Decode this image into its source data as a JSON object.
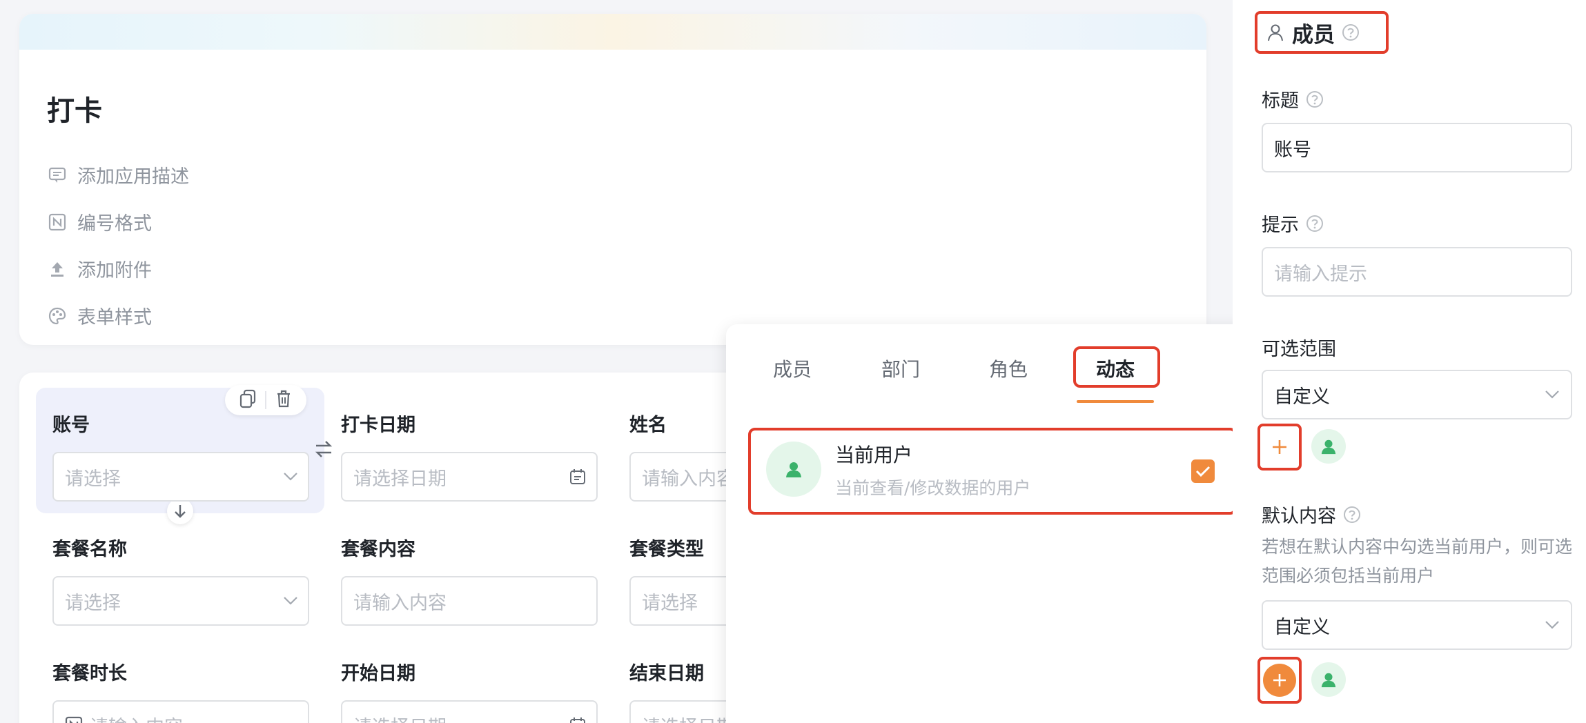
{
  "form": {
    "title": "打卡",
    "menu": [
      {
        "label": "添加应用描述",
        "icon": "comment-icon"
      },
      {
        "label": "编号格式",
        "icon": "number-format-icon"
      },
      {
        "label": "添加附件",
        "icon": "upload-icon"
      },
      {
        "label": "表单样式",
        "icon": "palette-icon"
      }
    ]
  },
  "fields": [
    {
      "label": "账号",
      "placeholder": "请选择",
      "type": "select"
    },
    {
      "label": "打卡日期",
      "placeholder": "请选择日期",
      "type": "date"
    },
    {
      "label": "姓名",
      "placeholder": "请输入内容",
      "type": "text"
    },
    {
      "label": "套餐名称",
      "placeholder": "请选择",
      "type": "select"
    },
    {
      "label": "套餐内容",
      "placeholder": "请输入内容",
      "type": "text"
    },
    {
      "label": "套餐类型",
      "placeholder": "请选择",
      "type": "select"
    },
    {
      "label": "套餐时长",
      "placeholder": "请输入内容",
      "type": "number"
    },
    {
      "label": "开始日期",
      "placeholder": "请选择日期",
      "type": "date"
    },
    {
      "label": "结束日期",
      "placeholder": "请选择日期",
      "type": "date"
    }
  ],
  "popup": {
    "tabs": [
      "成员",
      "部门",
      "角色",
      "动态"
    ],
    "active_tab": "动态",
    "option": {
      "title": "当前用户",
      "subtitle": "当前查看/修改数据的用户",
      "checked": true
    }
  },
  "panel": {
    "header": "成员",
    "title_label": "标题",
    "title_value": "账号",
    "hint_label": "提示",
    "hint_placeholder": "请输入提示",
    "range_label": "可选范围",
    "range_value": "自定义",
    "default_label": "默认内容",
    "default_hint": "若想在默认内容中勾选当前用户，则可选范围必须包括当前用户",
    "default_value": "自定义"
  },
  "colors": {
    "accent": "#f08a3c",
    "highlight_frame": "#e23d2b",
    "avatar_bg": "#e4f6ea",
    "avatar_fg": "#3bb26b"
  }
}
